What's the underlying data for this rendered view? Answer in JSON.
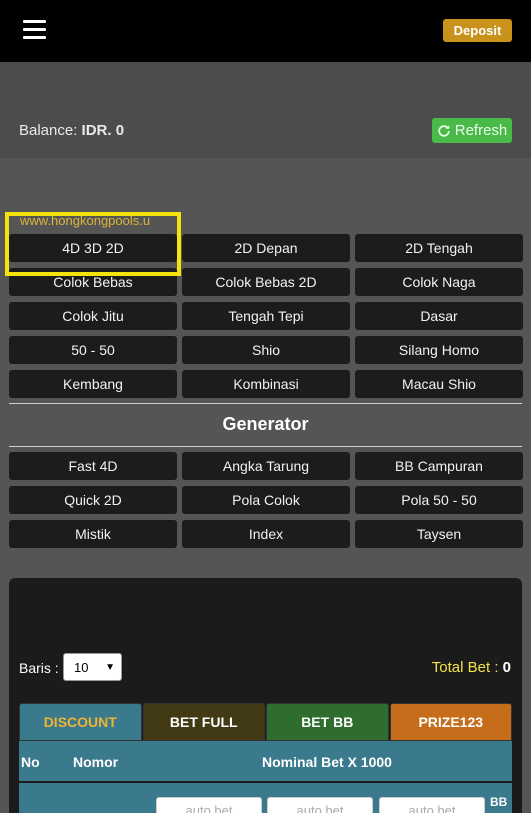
{
  "header": {
    "deposit_label": "Deposit"
  },
  "balance": {
    "label": "Balance:",
    "value": "IDR. 0"
  },
  "refresh_label": "Refresh",
  "site_url": "www.hongkongpools.u",
  "main_menu": [
    "4D 3D 2D",
    "2D Depan",
    "2D Tengah",
    "Colok Bebas",
    "Colok Bebas 2D",
    "Colok Naga",
    "Colok Jitu",
    "Tengah Tepi",
    "Dasar",
    "50 - 50",
    "Shio",
    "Silang Homo",
    "Kembang",
    "Kombinasi",
    "Macau Shio"
  ],
  "generator": {
    "title": "Generator",
    "items": [
      "Fast 4D",
      "Angka Tarung",
      "BB Campuran",
      "Quick 2D",
      "Pola Colok",
      "Pola 50 - 50",
      "Mistik",
      "Index",
      "Taysen"
    ]
  },
  "bet_panel": {
    "baris_label": "Baris :",
    "baris_value": "10",
    "total_bet_label": "Total Bet :",
    "total_bet_value": "0",
    "tabs": [
      "DISCOUNT",
      "BET FULL",
      "BET BB",
      "PRIZE123"
    ],
    "columns": {
      "no": "No",
      "nomor": "Nomor",
      "nominal": "Nominal Bet X 1000"
    },
    "input_placeholder": "auto bet",
    "bb_label": "BB"
  },
  "colors": {
    "deposit": "#c9921a",
    "refresh": "#49b948",
    "highlight": "#f5e30c",
    "total_bet": "#f3e34a",
    "table_header": "#3a7a8c"
  }
}
